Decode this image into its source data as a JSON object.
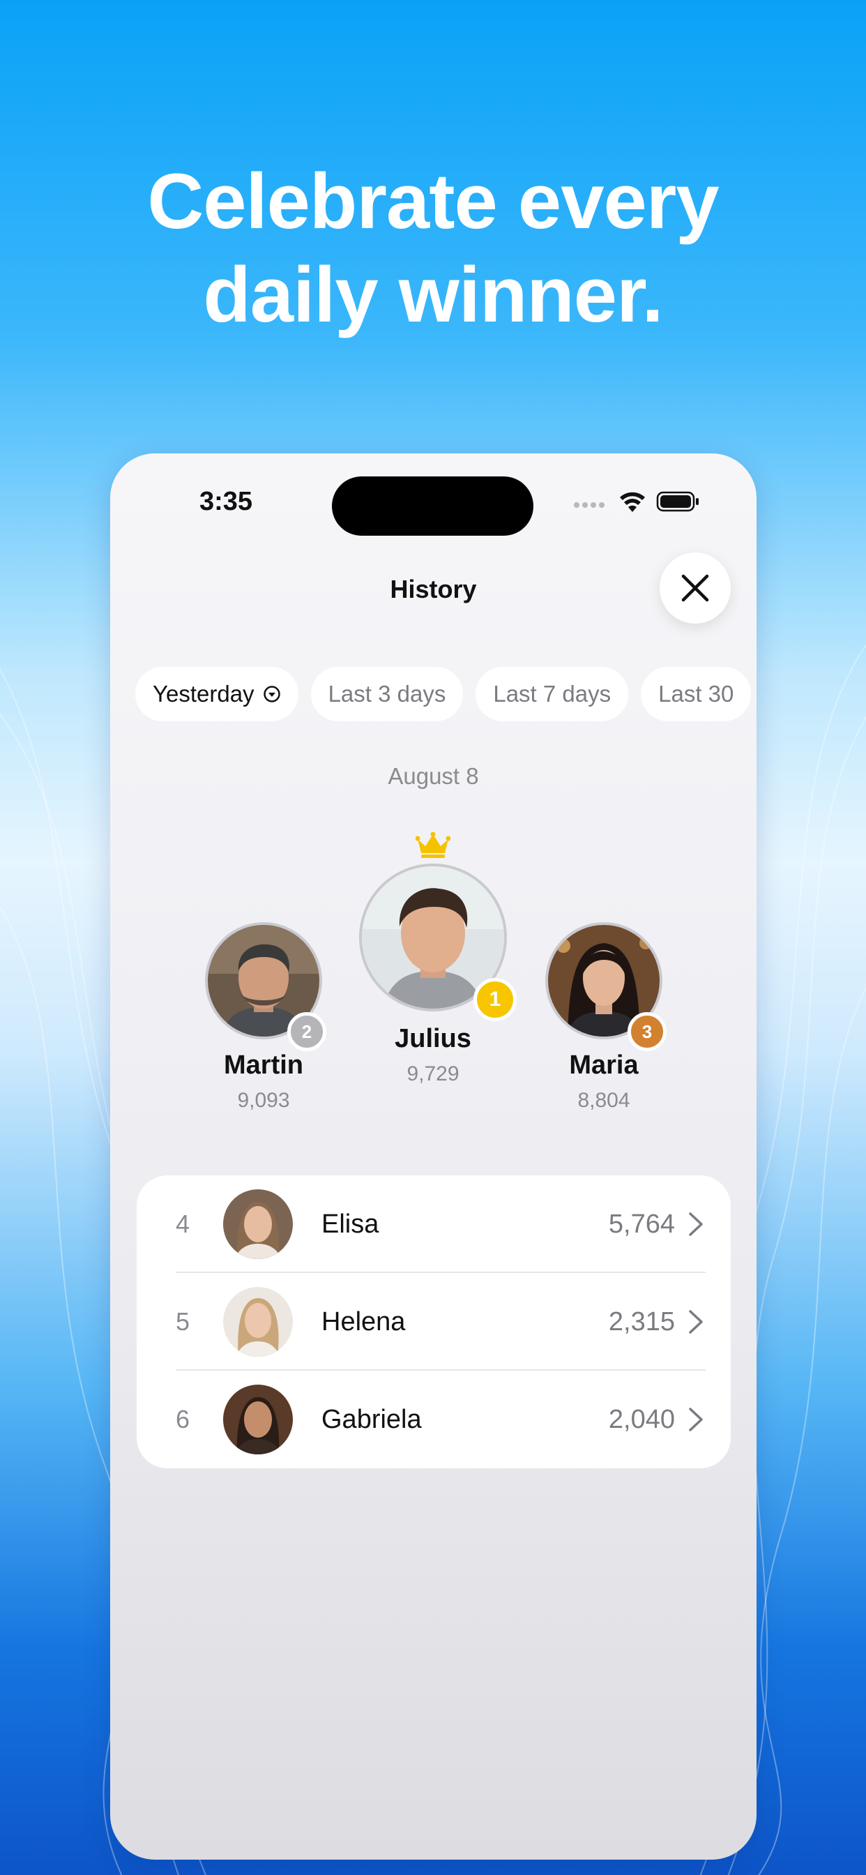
{
  "headline": {
    "line1": "Celebrate every",
    "line2": "daily winner."
  },
  "status_bar": {
    "time": "3:35"
  },
  "nav": {
    "title": "History",
    "close_icon": "close-icon"
  },
  "filters": [
    {
      "label": "Yesterday",
      "active": true,
      "icon": "dropdown-circle-icon"
    },
    {
      "label": "Last 3 days",
      "active": false
    },
    {
      "label": "Last 7 days",
      "active": false
    },
    {
      "label": "Last 30",
      "active": false
    }
  ],
  "date_label": "August 8",
  "podium": {
    "first": {
      "name": "Julius",
      "score": "9,729",
      "rank": "1",
      "badge_color": "#f7c600"
    },
    "second": {
      "name": "Martin",
      "score": "9,093",
      "rank": "2",
      "badge_color": "#b4b4b9"
    },
    "third": {
      "name": "Maria",
      "score": "8,804",
      "rank": "3",
      "badge_color": "#d1812f"
    },
    "crown_color": "#f6c200"
  },
  "leaderboard": [
    {
      "rank": "4",
      "name": "Elisa",
      "score": "5,764"
    },
    {
      "rank": "5",
      "name": "Helena",
      "score": "2,315"
    },
    {
      "rank": "6",
      "name": "Gabriela",
      "score": "2,040"
    }
  ]
}
